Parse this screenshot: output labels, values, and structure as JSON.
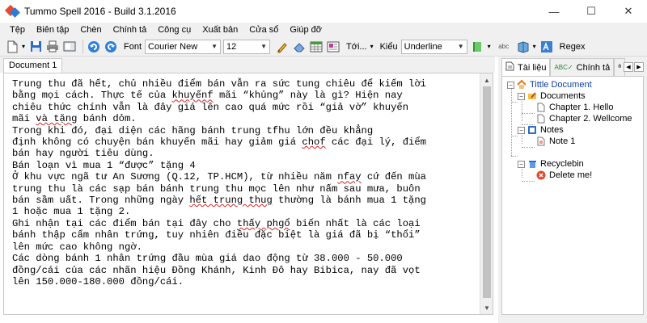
{
  "window": {
    "title": "Tummo Spell 2016 - Build 3.1.2016",
    "controls": {
      "minimize": "—",
      "maximize": "☐",
      "close": "✕"
    }
  },
  "menu": [
    "Tệp",
    "Biên tập",
    "Chèn",
    "Chính tả",
    "Công cụ",
    "Xuất bản",
    "Cửa sổ",
    "Giúp đỡ"
  ],
  "toolbar": {
    "font_label": "Font",
    "font_value": "Courier New",
    "size_value": "12",
    "style_value": "Tới...",
    "kieu_label": "Kiểu",
    "kieu_value": "Underline",
    "regex_label": "Regex",
    "abc_label": "abc"
  },
  "document": {
    "tab_label": "Document 1",
    "lines": [
      [
        {
          "t": "Trung thu đã hết, chủ nhiều điểm bán vẫn ra sức tung chiêu để kiếm lời"
        }
      ],
      [
        {
          "t": "bằng mọi cách. Thực tế của "
        },
        {
          "t": "khuyếnf",
          "s": true
        },
        {
          "t": " mãi “khủng” này là gì? Hiện nay"
        }
      ],
      [
        {
          "t": "chiêu thức chính vẫn là đây giá lên cao quá mức rồi “giả vờ” khuyến"
        }
      ],
      [
        {
          "t": "mãi "
        },
        {
          "t": "và tặng",
          "s": true
        },
        {
          "t": " bánh dỏm."
        }
      ],
      [
        {
          "t": "Trong khi đó, đại diện các hãng bánh trung tfhu lớn đều khẳng"
        }
      ],
      [
        {
          "t": "định không có chuyện bán khuyến mãi hay giảm giá "
        },
        {
          "t": "chof",
          "s": true
        },
        {
          "t": " các đại lý, điểm"
        }
      ],
      [
        {
          "t": "bán hay người tiêu dùng."
        }
      ],
      [
        {
          "t": "Bán loạn vì mua 1 “được” tặng 4"
        }
      ],
      [
        {
          "t": "Ở khu vực ngã tư An Sương (Q.12, TP.HCM), từ nhiều năm "
        },
        {
          "t": "nfay",
          "s": true
        },
        {
          "t": " cứ đến mùa"
        }
      ],
      [
        {
          "t": "trung thu là các sạp bán bánh trung thu mọc lên như nấm sau mưa, buôn"
        }
      ],
      [
        {
          "t": "bán sầm uất. Trong những ngày "
        },
        {
          "t": "hết trung thug",
          "s": true
        },
        {
          "t": " thường là bánh mua 1 tặng"
        }
      ],
      [
        {
          "t": "1 hoặc mua 1 tặng 2."
        }
      ],
      [
        {
          "t": "Ghi nhận tại các điểm bán tại đây cho "
        },
        {
          "t": "thấy phgổ",
          "s": true
        },
        {
          "t": " biến nhất là các loại"
        }
      ],
      [
        {
          "t": "bánh thập cẩm nhân trứng, tuy nhiên điều đặc biệt là giá đã bị “thổi”"
        }
      ],
      [
        {
          "t": "lên mức cao không ngờ."
        }
      ],
      [
        {
          "t": "Các dòng bánh 1 nhân trứng đầu mùa giá dao động từ 38.000 - 50.000"
        }
      ],
      [
        {
          "t": "đồng/cái của các nhãn hiệu Đồng Khánh, Kinh Đô hay Bibica, nay đã vọt"
        }
      ],
      [
        {
          "t": "lên 150.000-180.000 đồng/cái."
        }
      ]
    ]
  },
  "panel": {
    "tabs": [
      "Tài liệu",
      "Chính tả"
    ],
    "tree": {
      "root": "Tittle Document",
      "documents": "Documents",
      "chapter1": "Chapter 1. Hello",
      "chapter2": "Chapter 2. Wellcome",
      "notes": "Notes",
      "note1": "Note 1",
      "recyclebin": "Recyclebin",
      "deleteme": "Delete me!"
    }
  },
  "colors": {
    "spell_error": "#e02020",
    "tree_root_text": "#0a3fa5"
  }
}
